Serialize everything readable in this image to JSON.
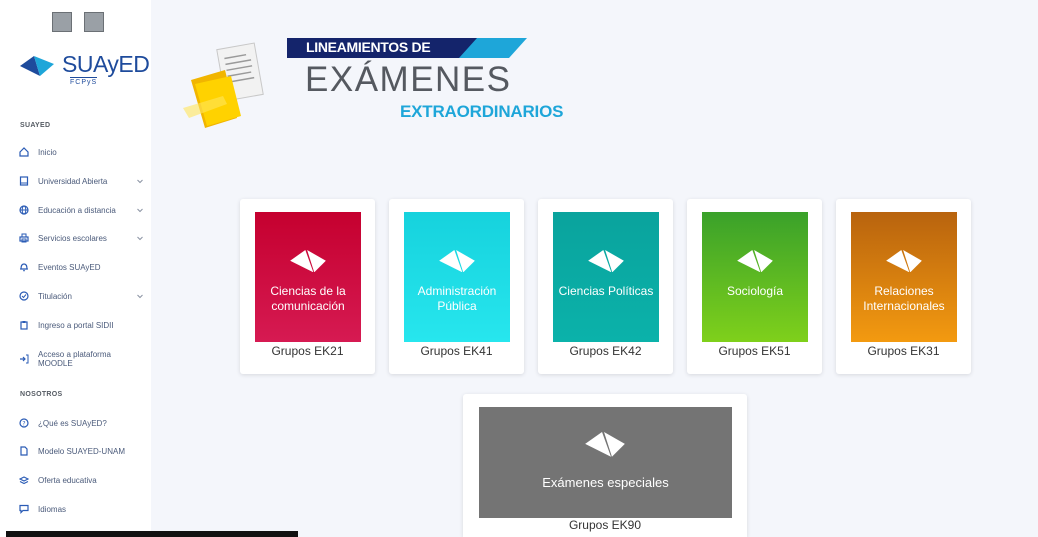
{
  "sidebar": {
    "logo_text": "SUAyED",
    "logo_sub": "FCPyS",
    "section1": "SUAYED",
    "items1": [
      {
        "label": "Inicio",
        "icon": "home-icon",
        "chev": false
      },
      {
        "label": "Universidad Abierta",
        "icon": "book-icon",
        "chev": true
      },
      {
        "label": "Educación a distancia",
        "icon": "globe-icon",
        "chev": true
      },
      {
        "label": "Servicios escolares",
        "icon": "printer-icon",
        "chev": true
      },
      {
        "label": "Eventos SUAyED",
        "icon": "bell-icon",
        "chev": false
      },
      {
        "label": "Titulación",
        "icon": "check-circle-icon",
        "chev": true
      },
      {
        "label": "Ingreso a portal SIDII",
        "icon": "clipboard-icon",
        "chev": false
      },
      {
        "label": "Acceso a plataforma MOODLE",
        "icon": "login-icon",
        "chev": false
      }
    ],
    "section2": "NOSOTROS",
    "items2": [
      {
        "label": "¿Qué es SUAyED?",
        "icon": "help-circle-icon",
        "chev": false
      },
      {
        "label": "Modelo SUAYED-UNAM",
        "icon": "file-icon",
        "chev": false
      },
      {
        "label": "Oferta educativa",
        "icon": "layers-icon",
        "chev": false
      },
      {
        "label": "Idiomas",
        "icon": "message-icon",
        "chev": false
      }
    ]
  },
  "header": {
    "banner": "LINEAMIENTOS DE",
    "title": "EXÁMENES",
    "subtitle": "EXTRAORDINARIOS"
  },
  "cards": [
    {
      "tile": "Ciencias de la comunicación",
      "group": "Grupos EK21",
      "color_top": "#c5002f",
      "color_bottom": "#d61a52"
    },
    {
      "tile": "Administración Pública",
      "group": "Grupos EK41",
      "color_top": "#16d2dd",
      "color_bottom": "#27e6ee"
    },
    {
      "tile": "Ciencias Políticas",
      "group": "Grupos EK42",
      "color_top": "#0aa39d",
      "color_bottom": "#0bb2aa"
    },
    {
      "tile": "Sociología",
      "group": "Grupos EK51",
      "color_top": "#3aa12a",
      "color_bottom": "#7fd01b"
    },
    {
      "tile": "Relaciones Internacionales",
      "group": "Grupos EK31",
      "color_top": "#b8630e",
      "color_bottom": "#f39a10"
    }
  ],
  "special": {
    "tile": "Exámenes especiales",
    "group": "Grupos EK90",
    "color": "#747474"
  }
}
